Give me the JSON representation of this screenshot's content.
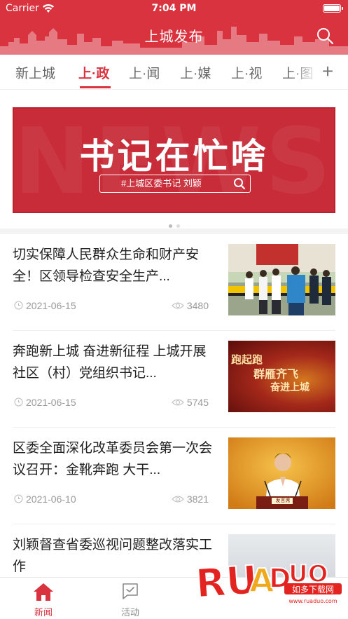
{
  "status_bar": {
    "carrier": "Carrier",
    "time": "7:04 PM"
  },
  "header": {
    "title": "上城发布",
    "search_icon": "search-icon"
  },
  "tabs": [
    {
      "label": "新上城",
      "active": false
    },
    {
      "label": "上·政",
      "active": true
    },
    {
      "label": "上·闻",
      "active": false
    },
    {
      "label": "上·媒",
      "active": false
    },
    {
      "label": "上·视",
      "active": false
    },
    {
      "label": "上·图",
      "active": false
    }
  ],
  "tab_add": "+",
  "banner": {
    "bg_text": "NEWS",
    "heading": "书记在忙啥",
    "tag": "#上城区委书记 刘颖"
  },
  "news": [
    {
      "title": "切实保障人民群众生命和财产安全！区领导检查安全生产...",
      "date": "2021-06-15",
      "views": "3480"
    },
    {
      "title": "奔跑新上城 奋进新征程 上城开展社区（村）党组织书记...",
      "date": "2021-06-15",
      "views": "5745"
    },
    {
      "title": "区委全面深化改革委员会第一次会议召开：金靴奔跑 大干...",
      "date": "2021-06-10",
      "views": "3821"
    },
    {
      "title": "刘颖督查省委巡视问题整改落实工作",
      "date": "",
      "views": ""
    }
  ],
  "thumb_texts": {
    "item2_line1": "跑起跑",
    "item2_line2": "群雁齐飞",
    "item2_line3": "奋进上城",
    "item3_nameplate": "发言席"
  },
  "tabbar": [
    {
      "label": "新闻",
      "icon": "home-icon",
      "active": true
    },
    {
      "label": "活动",
      "icon": "flag-icon",
      "active": false
    }
  ],
  "watermark": {
    "logo": "RUANDUO",
    "cn": "如多下载网",
    "url": "www.ruaduo.com"
  },
  "colors": {
    "brand": "#d9333f",
    "text": "#222222",
    "meta": "#999999"
  }
}
